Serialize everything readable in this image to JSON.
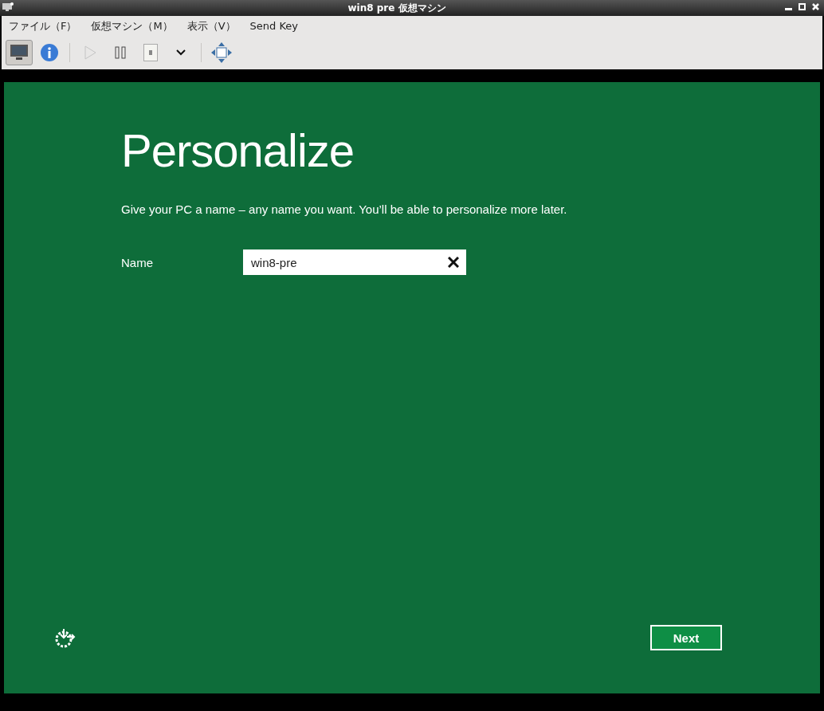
{
  "window": {
    "title": "win8  pre 仮想マシン"
  },
  "menu": [
    "ファイル（F）",
    "仮想マシン（M）",
    "表示（V）",
    "Send Key"
  ],
  "toolbar": [
    {
      "kind": "console",
      "selected": true,
      "disabled": false
    },
    {
      "kind": "info",
      "selected": false,
      "disabled": false
    },
    {
      "kind": "play",
      "selected": false,
      "disabled": true
    },
    {
      "kind": "pause",
      "selected": false,
      "disabled": false
    },
    {
      "kind": "power",
      "selected": false,
      "disabled": false
    },
    {
      "kind": "dropdown",
      "selected": false,
      "disabled": false
    },
    {
      "kind": "fullscreen",
      "selected": false,
      "disabled": false
    }
  ],
  "screen": {
    "heading": "Personalize",
    "description": "Give your PC a name – any name you want. You’ll be able to personalize more later.",
    "name_label": "Name",
    "name_value": "win8-pre",
    "next_button": "Next"
  }
}
